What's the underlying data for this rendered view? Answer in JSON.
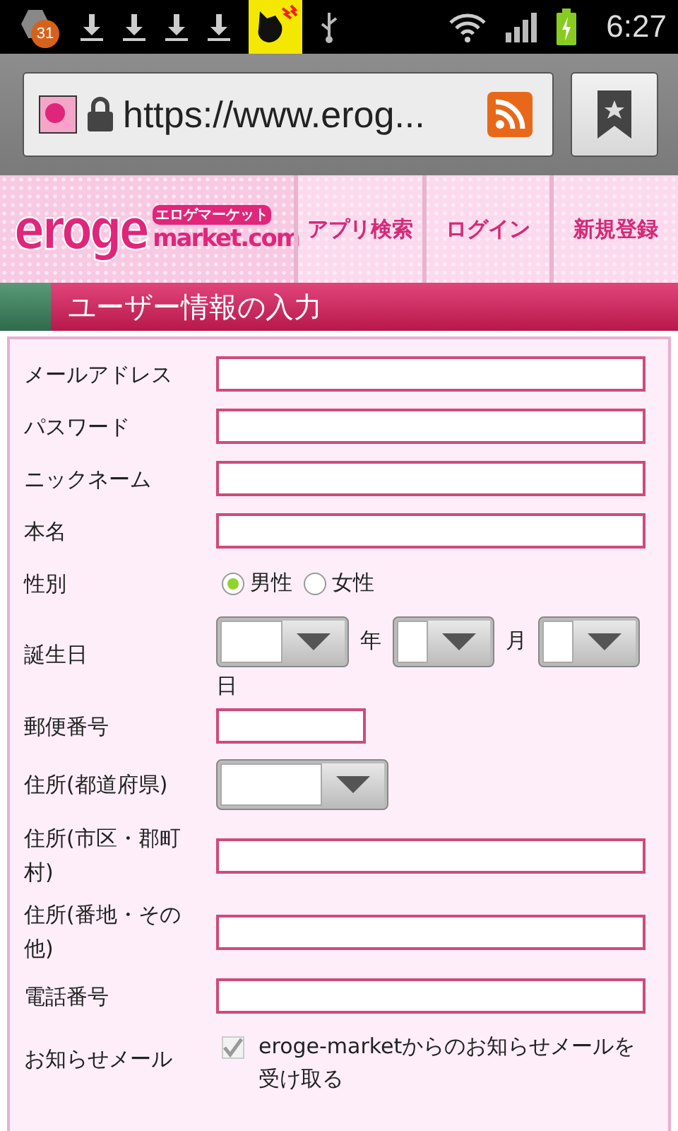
{
  "status_bar": {
    "notification_count": "31",
    "time": "6:27"
  },
  "browser": {
    "url": "https://www.erog..."
  },
  "header": {
    "logo": {
      "main": "eroge",
      "kana": "エロゲマーケット",
      "sub": "market.com"
    },
    "nav": [
      {
        "label": "アプリ検索"
      },
      {
        "label": "ログイン"
      },
      {
        "label": "新規登録"
      }
    ]
  },
  "section_title": "ユーザー情報の入力",
  "form": {
    "fields": [
      {
        "kind": "text",
        "label": "メールアドレス"
      },
      {
        "kind": "text",
        "label": "パスワード"
      },
      {
        "kind": "text",
        "label": "ニックネーム"
      },
      {
        "kind": "text",
        "label": "本名"
      },
      {
        "kind": "radio",
        "label": "性別",
        "options": [
          {
            "label": "男性",
            "selected": true
          },
          {
            "label": "女性",
            "selected": false
          }
        ]
      },
      {
        "kind": "date",
        "label": "誕生日",
        "parts": [
          {
            "kind": "year",
            "unit": "年"
          },
          {
            "kind": "month",
            "unit": "月"
          },
          {
            "kind": "day",
            "unit": "日"
          }
        ]
      },
      {
        "kind": "short_text",
        "label": "郵便番号"
      },
      {
        "kind": "select",
        "label": "住所(都道府県)"
      },
      {
        "kind": "text",
        "label": "住所(市区・郡町村)"
      },
      {
        "kind": "text",
        "label": "住所(番地・その他)"
      },
      {
        "kind": "text",
        "label": "電話番号"
      },
      {
        "kind": "checkbox",
        "label": "お知らせメール",
        "text": "eroge-marketからのお知らせメールを受け取る",
        "checked": true,
        "disabled": true
      }
    ]
  }
}
